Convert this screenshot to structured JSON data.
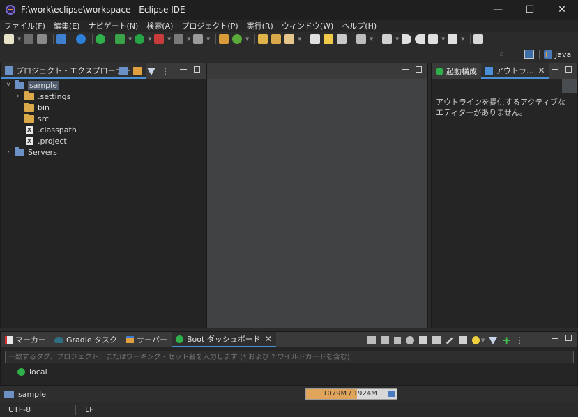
{
  "window": {
    "title": "F:\\work\\eclipse\\workspace - Eclipse IDE",
    "minimize_glyph": "—",
    "maximize_glyph": "☐",
    "close_glyph": "✕"
  },
  "menubar": {
    "items": [
      "ファイル(F)",
      "編集(E)",
      "ナビゲート(N)",
      "検索(A)",
      "プロジェクト(P)",
      "実行(R)",
      "ウィンドウ(W)",
      "ヘルプ(H)"
    ]
  },
  "perspective": {
    "java_label": "Java"
  },
  "explorer": {
    "tab_label": "プロジェクト・エクスプローラー",
    "close_glyph": "✕",
    "tree": [
      {
        "label": "sample",
        "chevron": "∨",
        "icon": "project-folder-icon"
      },
      {
        "label": ".settings",
        "chevron": "›",
        "icon": "folder-icon"
      },
      {
        "label": "bin",
        "chevron": "",
        "icon": "folder-icon"
      },
      {
        "label": "src",
        "chevron": "",
        "icon": "folder-icon"
      },
      {
        "label": ".classpath",
        "chevron": "",
        "icon": "xml-file-icon",
        "glyph": "X"
      },
      {
        "label": ".project",
        "chevron": "",
        "icon": "xml-file-icon",
        "glyph": "X"
      },
      {
        "label": "Servers",
        "chevron": "›",
        "icon": "project-folder-icon"
      }
    ]
  },
  "outline": {
    "tab_launch": "起動構成",
    "tab_outline": "アウトラ...",
    "close_glyph": "✕",
    "message": "アウトラインを提供するアクティブなエディターがありません。"
  },
  "bottom": {
    "tabs": [
      {
        "label": "マーカー"
      },
      {
        "label": "Gradle タスク"
      },
      {
        "label": "サーバー"
      },
      {
        "label": "Boot ダッシュボード"
      }
    ],
    "close_glyph": "✕",
    "filter_placeholder": "一致するタグ、プロジェクト、またはワーキング・セット名を入力します (* および ? ワイルドカードを含む)",
    "items": [
      {
        "label": "local"
      }
    ]
  },
  "status": {
    "selected": "sample",
    "heap": "1079M / 1924M",
    "heap_used_fraction": 0.56,
    "encoding": "UTF-8",
    "line_delimiter": "LF"
  },
  "colors": {
    "accent": "#4a8fd6",
    "folder": "#d9a94a",
    "project": "#6b91c6",
    "boot_green": "#2fb04a",
    "heap_fill": "#e0a55a"
  }
}
